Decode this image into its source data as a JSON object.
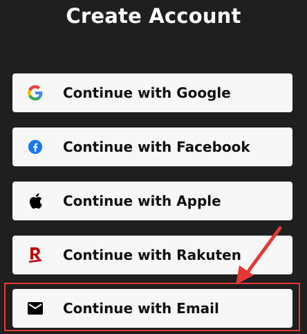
{
  "title": "Create Account",
  "buttons": [
    {
      "id": "google",
      "label": "Continue with Google",
      "icon": "google-icon"
    },
    {
      "id": "facebook",
      "label": "Continue with Facebook",
      "icon": "facebook-icon"
    },
    {
      "id": "apple",
      "label": "Continue with Apple",
      "icon": "apple-icon"
    },
    {
      "id": "rakuten",
      "label": "Continue with Rakuten",
      "icon": "rakuten-icon"
    },
    {
      "id": "email",
      "label": "Continue with Email",
      "icon": "mail-icon"
    }
  ],
  "colors": {
    "background": "#1f1f1f",
    "button_bg": "#f7f7f7",
    "highlight": "#e53935",
    "facebook": "#1877f2",
    "rakuten": "#bf0000"
  }
}
